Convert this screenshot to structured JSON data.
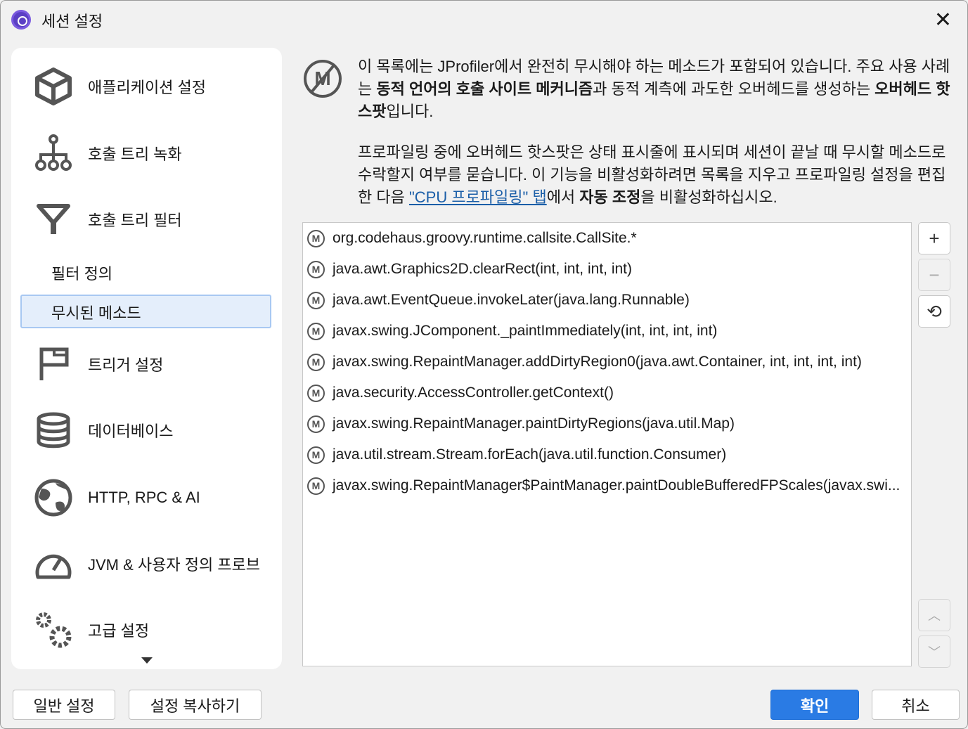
{
  "window": {
    "title": "세션 설정",
    "close_icon": "close-icon"
  },
  "sidebar": {
    "items": [
      {
        "label": "애플리케이션 설정",
        "icon": "cube-icon"
      },
      {
        "label": "호출 트리 녹화",
        "icon": "tree-icon"
      },
      {
        "label": "호출 트리 필터",
        "icon": "funnel-icon"
      },
      {
        "label": "트리거 설정",
        "icon": "flag-icon"
      },
      {
        "label": "데이터베이스",
        "icon": "database-icon"
      },
      {
        "label": "HTTP, RPC & AI",
        "icon": "globe-icon"
      },
      {
        "label": "JVM & 사용자 정의 프로브",
        "icon": "gauge-icon"
      },
      {
        "label": "고급 설정",
        "icon": "gears-icon"
      }
    ],
    "subitems": [
      {
        "label": "필터 정의"
      },
      {
        "label": "무시된 메소드",
        "selected": true
      }
    ]
  },
  "description": {
    "p1": {
      "a": "이 목록에는 JProfiler에서 완전히 무시해야 하는 메소드가 포함되어 있습니다. 주요 사용 사례는 ",
      "b1": "동적 언어의 호출 사이트 메커니즘",
      "c": "과 동적 계측에 과도한 오버헤드를 생성하는 ",
      "b2": "오버헤드 핫스팟",
      "d": "입니다."
    },
    "p2": {
      "a": "프로파일링 중에 오버헤드 핫스팟은 상태 표시줄에 표시되며 세션이 끝날 때 무시할 메소드로 수락할지 여부를 묻습니다. 이 기능을 비활성화하려면 목록을 지우고 프로파일링 설정을 편집한 다음 ",
      "link": "\"CPU 프로파일링\" 탭",
      "b": "에서 ",
      "bold": "자동 조정",
      "c": "을 비활성화하십시오."
    }
  },
  "methods": [
    "org.codehaus.groovy.runtime.callsite.CallSite.*",
    "java.awt.Graphics2D.clearRect(int, int, int, int)",
    "java.awt.EventQueue.invokeLater(java.lang.Runnable)",
    "javax.swing.JComponent._paintImmediately(int, int, int, int)",
    "javax.swing.RepaintManager.addDirtyRegion0(java.awt.Container, int, int, int, int)",
    "java.security.AccessController.getContext()",
    "javax.swing.RepaintManager.paintDirtyRegions(java.util.Map)",
    "java.util.stream.Stream.forEach(java.util.function.Consumer)",
    "javax.swing.RepaintManager$PaintManager.paintDoubleBufferedFPScales(javax.swi..."
  ],
  "method_badge": "M",
  "side_buttons": {
    "add": "+",
    "remove": "−",
    "reset": "⟲",
    "up": "︿",
    "down": "﹀"
  },
  "footer": {
    "general": "일반 설정",
    "copy": "설정 복사하기",
    "ok": "확인",
    "cancel": "취소"
  }
}
